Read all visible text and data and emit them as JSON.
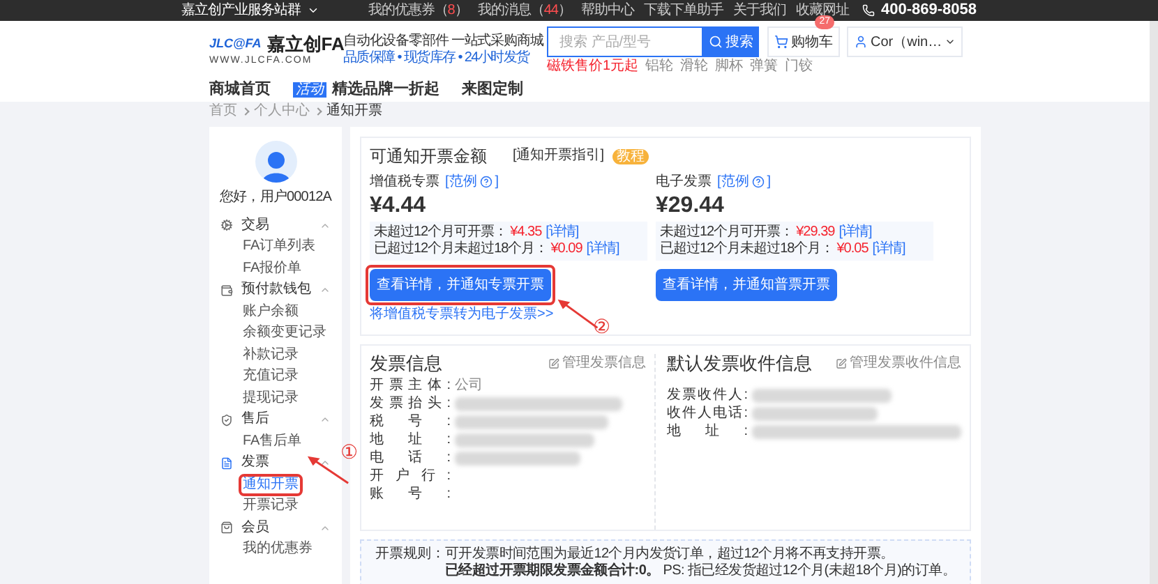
{
  "top_bar": {
    "site_menu": "嘉立创产业服务站群",
    "links": [
      {
        "label": "我的优惠券（",
        "count": "8",
        "suffix": "）"
      },
      {
        "label": "我的消息（",
        "count": "44",
        "suffix": "）"
      },
      {
        "label": "帮助中心"
      },
      {
        "label": "下载下单助手"
      },
      {
        "label": "关于我们"
      },
      {
        "label": "收藏网址"
      }
    ],
    "phone": "400-869-8058"
  },
  "header": {
    "logo_mark": "JLC@FA",
    "logo_name": "嘉立创FA",
    "logo_url": "WWW.JLCFA.COM",
    "slogan": "自动化设备零部件 一站式采购商城",
    "slogan_sub": "品质保障 • 现货库存 • 24小时发货",
    "search": {
      "placeholder": "搜索 产品/型号",
      "button": "搜索"
    },
    "hot_words": [
      {
        "label": "磁铁售价1元起",
        "promo": true
      },
      {
        "label": "铝轮",
        "promo": false
      },
      {
        "label": "滑轮",
        "promo": false
      },
      {
        "label": "脚杯",
        "promo": false
      },
      {
        "label": "弹簧",
        "promo": false
      },
      {
        "label": "门铰",
        "promo": false
      }
    ],
    "cart": {
      "label": "购物车",
      "badge": "27"
    },
    "user": "Cor（win…"
  },
  "nav": [
    {
      "label": "商城首页"
    },
    {
      "label": "精选品牌一折起",
      "tag": "活动"
    },
    {
      "label": "来图定制"
    }
  ],
  "breadcrumb": [
    "首页",
    "个人中心",
    "通知开票"
  ],
  "sidebar": {
    "greeting": "您好，用户00012A",
    "groups": [
      {
        "label": "交易",
        "expanded": true,
        "children": [
          {
            "label": "FA订单列表",
            "selected": false
          },
          {
            "label": "FA报价单",
            "selected": false
          }
        ]
      },
      {
        "label": "预付款钱包",
        "expanded": true,
        "children": [
          {
            "label": "账户余额",
            "selected": false
          },
          {
            "label": "余额变更记录",
            "selected": false
          },
          {
            "label": "补款记录",
            "selected": false
          },
          {
            "label": "充值记录",
            "selected": false
          },
          {
            "label": "提现记录",
            "selected": false
          }
        ]
      },
      {
        "label": "售后",
        "expanded": true,
        "children": [
          {
            "label": "FA售后单",
            "selected": false
          }
        ]
      },
      {
        "label": "发票",
        "expanded": true,
        "children": [
          {
            "label": "通知开票",
            "selected": true,
            "callout": "①"
          },
          {
            "label": "开票记录",
            "selected": false
          }
        ]
      },
      {
        "label": "会员",
        "expanded": true,
        "children": [
          {
            "label": "我的优惠券",
            "selected": false
          }
        ]
      }
    ]
  },
  "amounts": {
    "title": "可通知开票金额",
    "guide_link": "[通知开票指引]",
    "guide_tag": "教程",
    "columns": [
      {
        "label": "增值税专票",
        "example_link": "[范例",
        "example_close": "]",
        "amount": "¥4.44",
        "details": [
          {
            "label": "未超过12个月可开票：",
            "value": "¥4.35",
            "link": "[详情]"
          },
          {
            "label": "已超过12个月未超过18个月：",
            "value": "¥0.09",
            "link": "[详情]"
          }
        ],
        "button": "查看详情，并通知专票开票",
        "callout": "②",
        "convert_link": "将增值税专票转为电子发票>>"
      },
      {
        "label": "电子发票",
        "example_link": "[范例",
        "example_close": "]",
        "amount": "¥29.44",
        "details": [
          {
            "label": "未超过12个月可开票：",
            "value": "¥29.39",
            "link": "[详情]"
          },
          {
            "label": "已超过12个月未超过18个月：",
            "value": "¥0.05",
            "link": "[详情]"
          }
        ],
        "button": "查看详情，并通知普票开票"
      }
    ]
  },
  "invoice_info": {
    "title": "发票信息",
    "manage": "管理发票信息",
    "fields": [
      {
        "label": "开票主体:",
        "value": "公司",
        "blurred": false
      },
      {
        "label": "发票抬头:",
        "blurred": true
      },
      {
        "label": "税号:",
        "blurred": true
      },
      {
        "label": "地址:",
        "blurred": true
      },
      {
        "label": "电话:",
        "blurred": true
      },
      {
        "label": "开户行:",
        "blurred": false
      },
      {
        "label": "账号:",
        "blurred": false
      }
    ]
  },
  "recipient_info": {
    "title": "默认发票收件信息",
    "manage": "管理发票收件信息",
    "fields": [
      {
        "label": "发票收件人:",
        "blurred": true
      },
      {
        "label": "收件人电话:",
        "blurred": true
      },
      {
        "label": "地址:",
        "blurred": true
      }
    ]
  },
  "rules": {
    "label": "开票规则：",
    "lines": [
      "可开发票时间范围为最近12个月内发货订单，超过12个月将不再支持开票。",
      "**已经超过开票期限发票金额合计:0。** PS: 指已经发货超过12个月(未超18个月)的订单。"
    ]
  }
}
